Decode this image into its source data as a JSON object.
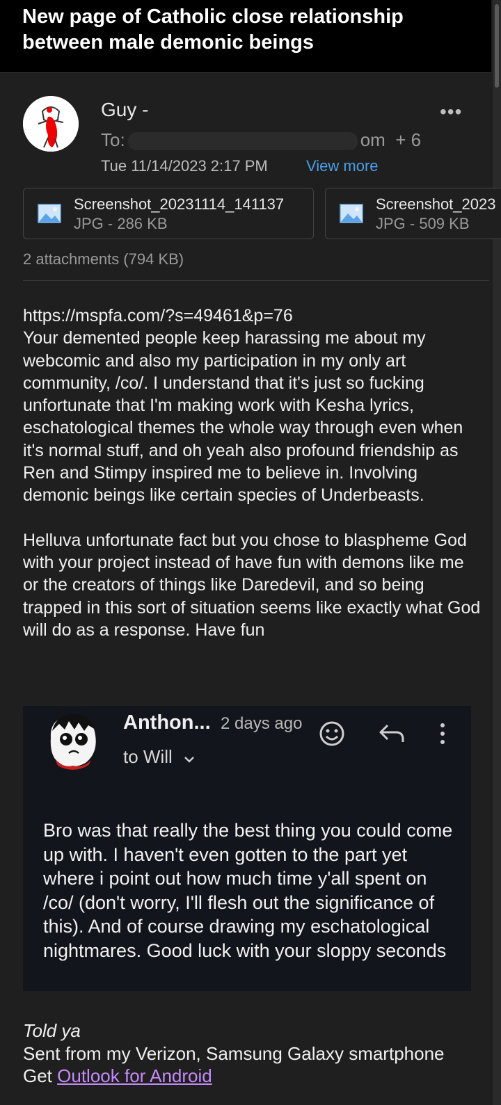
{
  "header": {
    "title": "New page of Catholic close relationship between male demonic beings"
  },
  "message": {
    "sender": "Guy -",
    "to_prefix": "To:",
    "to_suffix": "om",
    "more_recipients": "+ 6",
    "date": "Tue 11/14/2023 2:17 PM",
    "view_more": "View more",
    "more_icon": "more-horizontal-icon"
  },
  "attachments": {
    "items": [
      {
        "name": "Screenshot_20231114_141137",
        "meta": "JPG - 286 KB",
        "icon": "image-file-icon"
      },
      {
        "name": "Screenshot_2023",
        "meta": "JPG - 509 KB",
        "icon": "image-file-icon"
      }
    ],
    "summary": "2 attachments (794 KB)"
  },
  "body": {
    "link": "https://mspfa.com/?s=49461&p=76",
    "paragraph1": "Your demented people keep harassing me about my webcomic and also my participation in my only art community, /co/. I understand that it's just so fucking unfortunate that I'm making work with Kesha lyrics, eschatological themes the whole way through even when it's normal stuff, and oh yeah also profound friendship as Ren and Stimpy inspired me to believe in. Involving demonic beings like certain species of Underbeasts.",
    "paragraph2": "Helluva unfortunate fact but you chose to blaspheme God with your project instead of have fun with demons like me or the creators of things like Daredevil, and so being trapped in this sort of situation seems like exactly what God will do as a response. Have fun"
  },
  "quoted": {
    "name": "Anthon...",
    "time": "2 days ago",
    "to": "to Will",
    "body": "Bro was that really the best thing you could come up with. I haven't even gotten to the part yet where i point out how much time y'all spent on /co/ (don't worry, I'll flesh out the significance of this). And of course drawing my eschatological nightmares. Good luck with your sloppy seconds",
    "icons": [
      "emoji-icon",
      "reply-icon",
      "more-vertical-icon",
      "chevron-down-icon"
    ]
  },
  "signature": {
    "told": "Told ya",
    "sent_from": "Sent from my Verizon, Samsung Galaxy smartphone",
    "get_prefix": "Get ",
    "outlook_link": "Outlook for Android"
  },
  "colors": {
    "background": "#1f1f1f",
    "header_bg": "#000000",
    "link_blue": "#4a9ee8",
    "link_purple": "#c58af9",
    "quote_bg": "#12151b"
  }
}
